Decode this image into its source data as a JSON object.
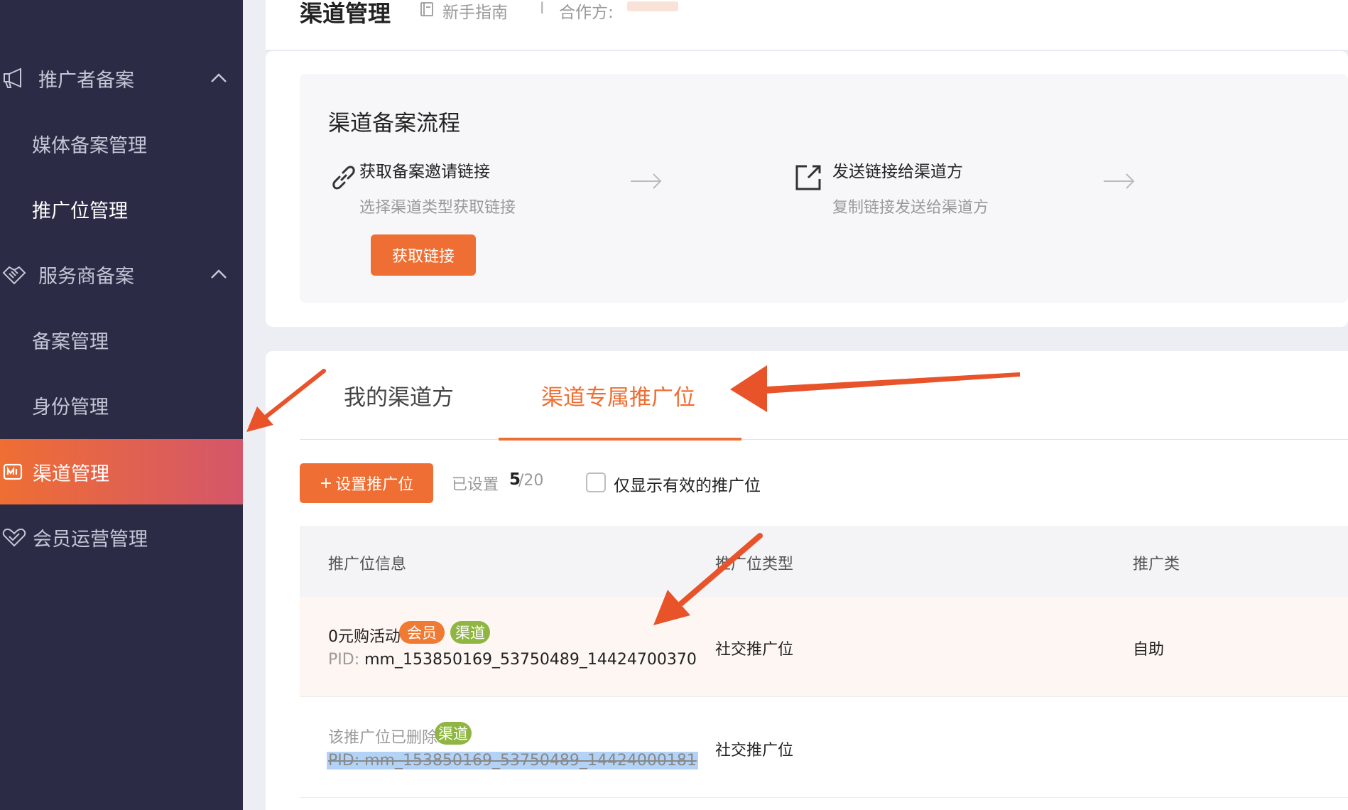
{
  "sidebar": {
    "groups": [
      {
        "label": "推广者备案",
        "icon": "megaphone-icon",
        "items": [
          {
            "label": "媒体备案管理"
          },
          {
            "label": "推广位管理"
          }
        ]
      },
      {
        "label": "服务商备案",
        "icon": "handshake-icon",
        "items": [
          {
            "label": "备案管理"
          },
          {
            "label": "身份管理"
          }
        ]
      }
    ],
    "active": {
      "label": "渠道管理",
      "icon": "channel-icon"
    },
    "member_ops": {
      "label": "会员运营管理",
      "icon": "heart-check-icon"
    }
  },
  "header": {
    "title": "渠道管理",
    "guide_label": "新手指南",
    "separator": "I",
    "partner_label": "合作方:"
  },
  "flow": {
    "title": "渠道备案流程",
    "steps": [
      {
        "title": "获取备案邀请链接",
        "desc": "选择渠道类型获取链接",
        "button": "获取链接",
        "icon": "link-icon"
      },
      {
        "title": "发送链接给渠道方",
        "desc": "复制链接发送给渠道方",
        "icon": "share-icon"
      }
    ]
  },
  "tabs": [
    {
      "label": "我的渠道方"
    },
    {
      "label": "渠道专属推广位"
    }
  ],
  "toolbar": {
    "add_button": "设置推广位",
    "add_plus": "+",
    "count_prefix": "已设置",
    "count_current": "5",
    "count_total": "/20",
    "filter_label": "仅显示有效的推广位"
  },
  "table": {
    "columns": [
      "推广位信息",
      "推广位类型",
      "推广类"
    ],
    "rows": [
      {
        "name": "0元购活动",
        "tags": [
          "会员",
          "渠道"
        ],
        "pid_label": "PID:",
        "pid": "mm_153850169_53750489_14424700370",
        "type": "社交推广位",
        "mode": "自助",
        "deleted": false
      },
      {
        "name": "该推广位已删除",
        "tags": [
          "渠道"
        ],
        "pid_label": "PID:",
        "pid": "mm_153850169_53750489_14424000181",
        "type": "社交推广位",
        "mode": "",
        "deleted": true
      }
    ]
  },
  "colors": {
    "accent": "#ef6e33",
    "sidebar_bg": "#2b2b45",
    "tag_channel": "#8fb543",
    "tag_member": "#ef7a33",
    "annotation": "#e8532a"
  }
}
